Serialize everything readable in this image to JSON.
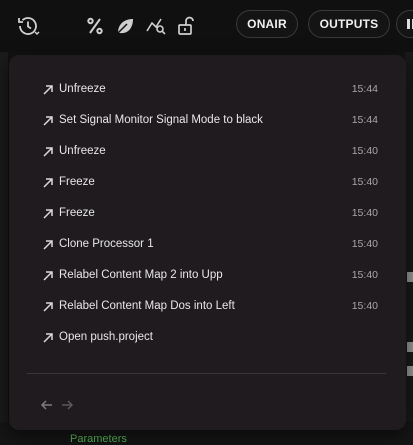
{
  "toolbar": {
    "history_icon": "history-clock-icon",
    "percent_icon": "percent-icon",
    "leaf_icon": "leaf-icon",
    "chart_search_icon": "chart-search-icon",
    "unlock_icon": "unlock-icon",
    "onair_label": "ONAIR",
    "outputs_label": "OUTPUTS"
  },
  "history": {
    "items": [
      {
        "label": "Unfreeze",
        "time": "15:44"
      },
      {
        "label": "Set Signal Monitor Signal Mode to black",
        "time": "15:44"
      },
      {
        "label": "Unfreeze",
        "time": "15:40"
      },
      {
        "label": "Freeze",
        "time": "15:40"
      },
      {
        "label": "Freeze",
        "time": "15:40"
      },
      {
        "label": "Clone Processor 1",
        "time": "15:40"
      },
      {
        "label": "Relabel Content Map 2 into Upp",
        "time": "15:40"
      },
      {
        "label": "Relabel Content Map Dos into Left",
        "time": "15:40"
      },
      {
        "label": "Open push.project",
        "time": ""
      }
    ]
  },
  "background": {
    "parameters_label": "Parameters"
  }
}
